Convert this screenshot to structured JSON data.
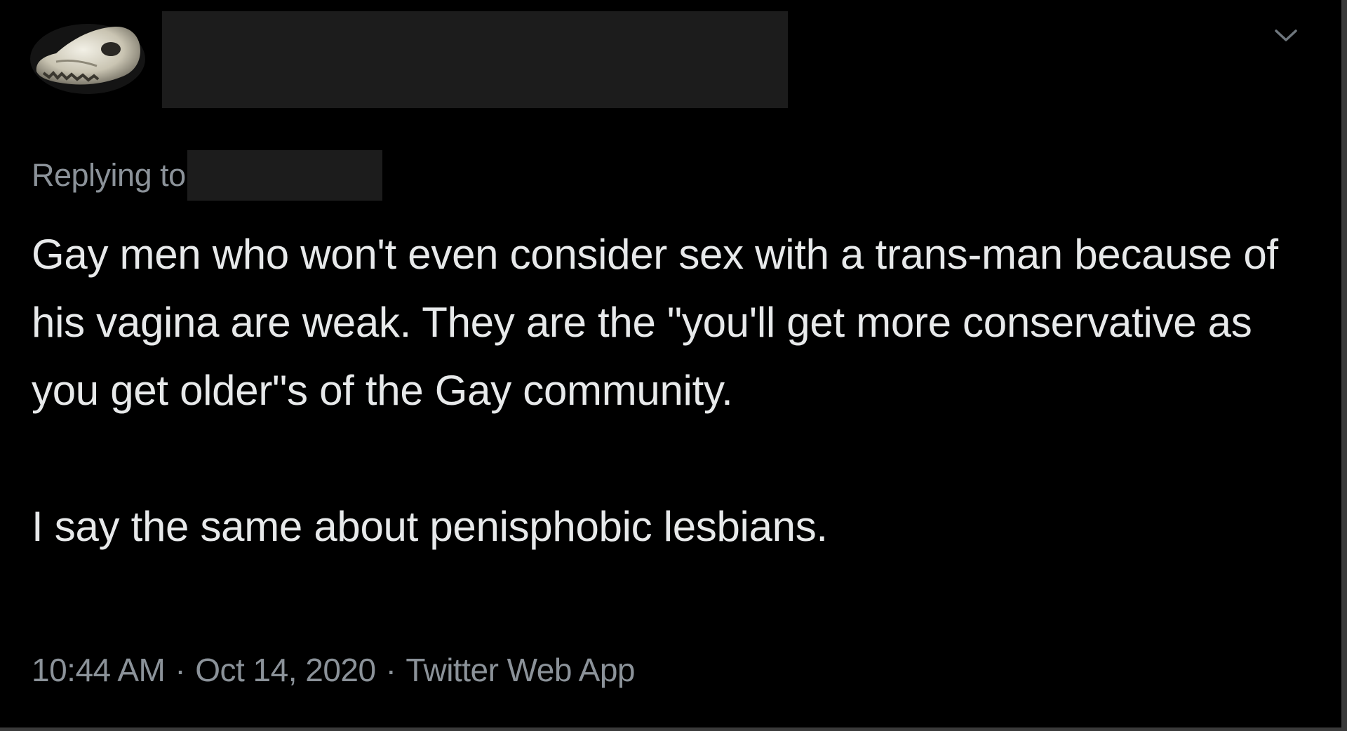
{
  "tweet": {
    "author_avatar_icon": "animal-skull-avatar-icon",
    "more_options_icon": "chevron-down-icon",
    "replying_to_label": "Replying to",
    "paragraphs": [
      "Gay men who won't even consider sex with a trans-man because of his vagina are weak. They are the \"you'll get more conservative as you get older\"s of the Gay community.",
      "I say the same about penisphobic lesbians."
    ],
    "time": "10:44 AM",
    "date": "Oct 14, 2020",
    "source": "Twitter Web App",
    "separator": "·"
  },
  "colors": {
    "background": "#000000",
    "primary_text": "#e7e9ea",
    "secondary_text": "#8b9299",
    "redaction": "#1c1c1c"
  }
}
